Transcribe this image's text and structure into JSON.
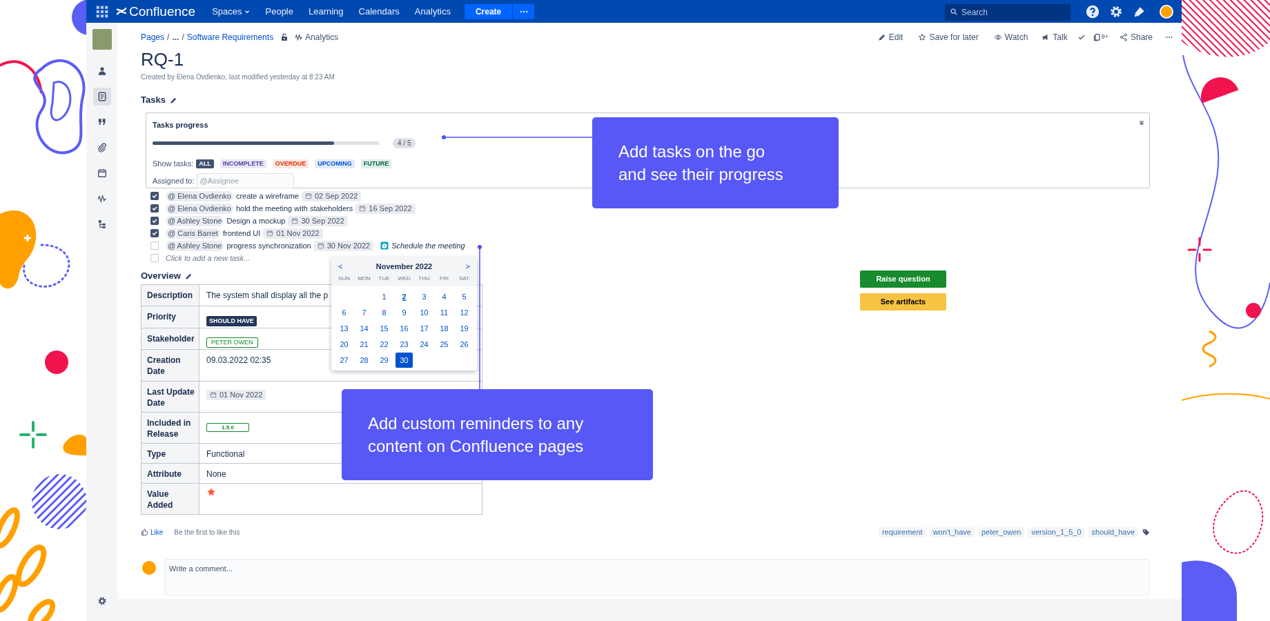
{
  "top_nav": {
    "product": "Confluence",
    "menu": [
      {
        "label": "Spaces",
        "dropdown": true
      },
      {
        "label": "People",
        "dropdown": false
      },
      {
        "label": "Learning",
        "dropdown": false
      },
      {
        "label": "Calendars",
        "dropdown": false
      },
      {
        "label": "Analytics",
        "dropdown": false
      }
    ],
    "create_button": "Create",
    "search": {
      "placeholder": "Search"
    }
  },
  "sidebar": {
    "items": [
      {
        "selected": false
      },
      {
        "selected": true
      },
      {
        "selected": false
      },
      {
        "selected": false
      },
      {
        "selected": false
      },
      {
        "selected": false
      },
      {
        "selected": false
      }
    ]
  },
  "breadcrumbs": [
    {
      "label": "Pages"
    },
    {
      "separator": "/",
      "label": "..."
    },
    {
      "separator": "/",
      "label": "Software Requirements"
    }
  ],
  "analytics_link": "Analytics",
  "page_actions": [
    {
      "kind": "edit",
      "label": "Edit"
    },
    {
      "kind": "save",
      "label": "Save for later"
    },
    {
      "kind": "watch",
      "label": "Watch"
    },
    {
      "kind": "talk",
      "label": "Talk"
    },
    {
      "kind": "resolve"
    },
    {
      "kind": "copies",
      "label": "9+"
    },
    {
      "kind": "share",
      "label": "Share"
    },
    {
      "kind": "more"
    }
  ],
  "page": {
    "title": "RQ-1",
    "meta": "Created by Elena Ovdienko, last modified yesterday at 8:23 AM"
  },
  "tasks": {
    "heading": "Tasks",
    "progress": {
      "title": "Tasks progress",
      "level": 0.8,
      "count": "4 / 5"
    },
    "filter_label": "Show tasks:",
    "filters": [
      {
        "label": "ALL",
        "selected": true,
        "color": "#42526e"
      },
      {
        "label": "INCOMPLETE",
        "selected": false,
        "color": "#5243aa"
      },
      {
        "label": "OVERDUE",
        "selected": false,
        "color": "#de350b"
      },
      {
        "label": "UPCOMING",
        "selected": false,
        "color": "#0052cc"
      },
      {
        "label": "FUTURE",
        "selected": false,
        "color": "#006644"
      }
    ],
    "assigned_label": "Assigned to:",
    "assignee_field": {
      "placeholder": "@Assignee"
    },
    "items": [
      {
        "checked": true,
        "assignee": "@ Elena Ovdienko",
        "text": "create a wireframe",
        "date": "02 Sep 2022"
      },
      {
        "checked": true,
        "assignee": "@ Elena Ovdienko",
        "text": "hold the meeting with stakeholders",
        "date": "16 Sep 2022"
      },
      {
        "checked": true,
        "assignee": "@ Ashley Stone",
        "text": "Design a mockup",
        "date": "30 Sep 2022"
      },
      {
        "checked": true,
        "assignee": "@ Caris Barret",
        "text": "frontend UI",
        "date": "01 Nov 2022"
      },
      {
        "checked": false,
        "assignee": "@ Ashley Stone",
        "text": "progress synchronization",
        "date": "30 Nov 2022",
        "reminder": "Schedule the meeting"
      }
    ],
    "new_task": {
      "checked": false,
      "placeholder": "Click to add a new task..."
    }
  },
  "calendar": {
    "prev": "<",
    "month": "November 2022",
    "next": ">",
    "weekdays": [
      "SUN",
      "MON",
      "TUE",
      "WED",
      "THU",
      "FRI",
      "SAT"
    ],
    "weeks": [
      [
        {
          "label": "1",
          "today": false,
          "selected": false
        },
        {
          "label": "2",
          "today": true,
          "selected": false
        },
        {
          "label": "3",
          "today": false,
          "selected": false
        },
        {
          "label": "4",
          "today": false,
          "selected": false
        },
        {
          "label": "5",
          "today": false,
          "selected": false
        }
      ],
      [
        {
          "label": "6",
          "today": false,
          "selected": false
        },
        {
          "label": "7",
          "today": false,
          "selected": false
        },
        {
          "label": "8",
          "today": false,
          "selected": false
        },
        {
          "label": "9",
          "today": false,
          "selected": false
        },
        {
          "label": "10",
          "today": false,
          "selected": false
        },
        {
          "label": "11",
          "today": false,
          "selected": false
        },
        {
          "label": "12",
          "today": false,
          "selected": false
        }
      ],
      [
        {
          "label": "13",
          "today": false,
          "selected": false
        },
        {
          "label": "14",
          "today": false,
          "selected": false
        },
        {
          "label": "15",
          "today": false,
          "selected": false
        },
        {
          "label": "16",
          "today": false,
          "selected": false
        },
        {
          "label": "17",
          "today": false,
          "selected": false
        },
        {
          "label": "18",
          "today": false,
          "selected": false
        },
        {
          "label": "19",
          "today": false,
          "selected": false
        }
      ],
      [
        {
          "label": "20",
          "today": false,
          "selected": false
        },
        {
          "label": "21",
          "today": false,
          "selected": false
        },
        {
          "label": "22",
          "today": false,
          "selected": false
        },
        {
          "label": "23",
          "today": false,
          "selected": false
        },
        {
          "label": "24",
          "today": false,
          "selected": false
        },
        {
          "label": "25",
          "today": false,
          "selected": false
        },
        {
          "label": "26",
          "today": false,
          "selected": false
        }
      ],
      [
        {
          "label": "27",
          "today": false,
          "selected": false
        },
        {
          "label": "28",
          "today": false,
          "selected": false
        },
        {
          "label": "29",
          "today": false,
          "selected": false
        },
        {
          "label": "30",
          "today": false,
          "selected": true
        }
      ]
    ]
  },
  "overview": {
    "heading": "Overview",
    "rows": [
      {
        "label": "Description",
        "kind": "text",
        "value": "The system shall display all the p"
      },
      {
        "label": "Priority",
        "kind": "status",
        "value": "SHOULD HAVE"
      },
      {
        "label": "Stakeholder",
        "kind": "outline",
        "value": "PETER OWEN"
      },
      {
        "label": "Creation Date",
        "kind": "text",
        "value": "09.03.2022 02:35"
      },
      {
        "label": "Last Update Date",
        "kind": "date",
        "value": "01 Nov 2022"
      },
      {
        "label": "Included in Release",
        "kind": "version",
        "value": "1.5.0"
      },
      {
        "label": "Type",
        "kind": "text",
        "value": "Functional"
      },
      {
        "label": "Attribute",
        "kind": "text",
        "value": "None"
      },
      {
        "label": "Value Added",
        "kind": "star_icon"
      }
    ]
  },
  "side_buttons": [
    {
      "kind": "success",
      "label": "Raise question"
    },
    {
      "kind": "warning",
      "label": "See artifacts"
    }
  ],
  "like": {
    "label": "Like",
    "note": "Be the first to like this"
  },
  "labels": [
    "requirement",
    "won't_have",
    "peter_owen",
    "version_1_5_0",
    "should_have"
  ],
  "comment": {
    "placeholder": "Write a comment..."
  },
  "callouts": [
    {
      "text": "Add tasks on the go and see their progress"
    },
    {
      "text": "Add custom reminders to any content on Confluence pages"
    }
  ]
}
